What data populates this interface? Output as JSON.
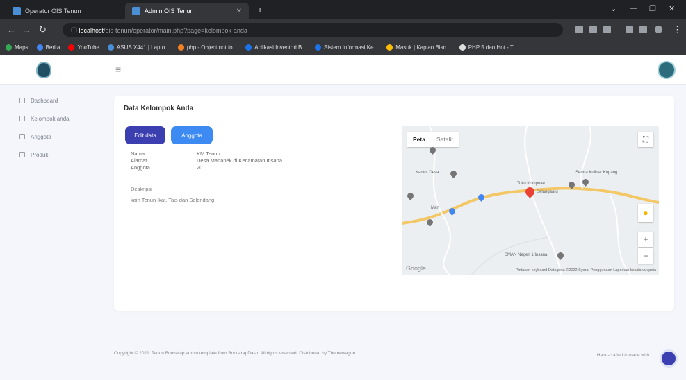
{
  "browser": {
    "tabs": [
      {
        "title": "Operator OIS Tenun"
      },
      {
        "title": "Admin OIS Tenun"
      }
    ],
    "url_host": "localhost",
    "url_rest": "/ois-tenun/operator/main.php?page=kelompok-anda",
    "bookmarks": [
      "Maps",
      "Berita",
      "YouTube",
      "ASUS X441 | Lapto...",
      "php - Object not fo...",
      "Aplikasi Inventori B...",
      "Sistem Informasi Ke...",
      "Masuk | Kaplan Bisn...",
      "PHP 5 dan Hot - Ti..."
    ]
  },
  "sidebar": {
    "items": [
      {
        "label": "Dashboard"
      },
      {
        "label": "Kelompok anda"
      },
      {
        "label": "Anggota"
      },
      {
        "label": "Produk"
      }
    ]
  },
  "main": {
    "title": "Data Kelompok Anda",
    "buttons": {
      "edit": "Edit data",
      "anggota": "Anggota"
    },
    "info": [
      {
        "key": "Nama",
        "value": "KM Tenun"
      },
      {
        "key": "Alamat",
        "value": "Desa Mananek di Kecamatan Insana"
      },
      {
        "key": "Anggota",
        "value": "20"
      }
    ],
    "deskripsi_label": "Deskripsi",
    "deskripsi": "kain Tenun Ikat, Tais dan Selendang"
  },
  "map": {
    "tab_map": "Peta",
    "tab_sat": "Satelit",
    "pois": [
      "Sentra Kulinar Kupang",
      "Toko Komputer",
      "Mart",
      "SMAN Negeri 1 Insana",
      "Kantor Desa"
    ],
    "marker_label": "Selangaaru",
    "google": "Google",
    "attribution": "Pintasan keyboard   Data peta ©2022   Syarat Penggunaan   Laporkan kesalahan peta"
  },
  "footer": {
    "left": "Copyright © 2021. Tenun Bootstrap admin template from BootstrapDash. All rights reserved. Distributed by Themewagon",
    "right": "Hand-crafted & made with"
  },
  "colors": {
    "primary": "#3b3fb0",
    "info": "#3d8af2",
    "marker": "#ea4335"
  }
}
